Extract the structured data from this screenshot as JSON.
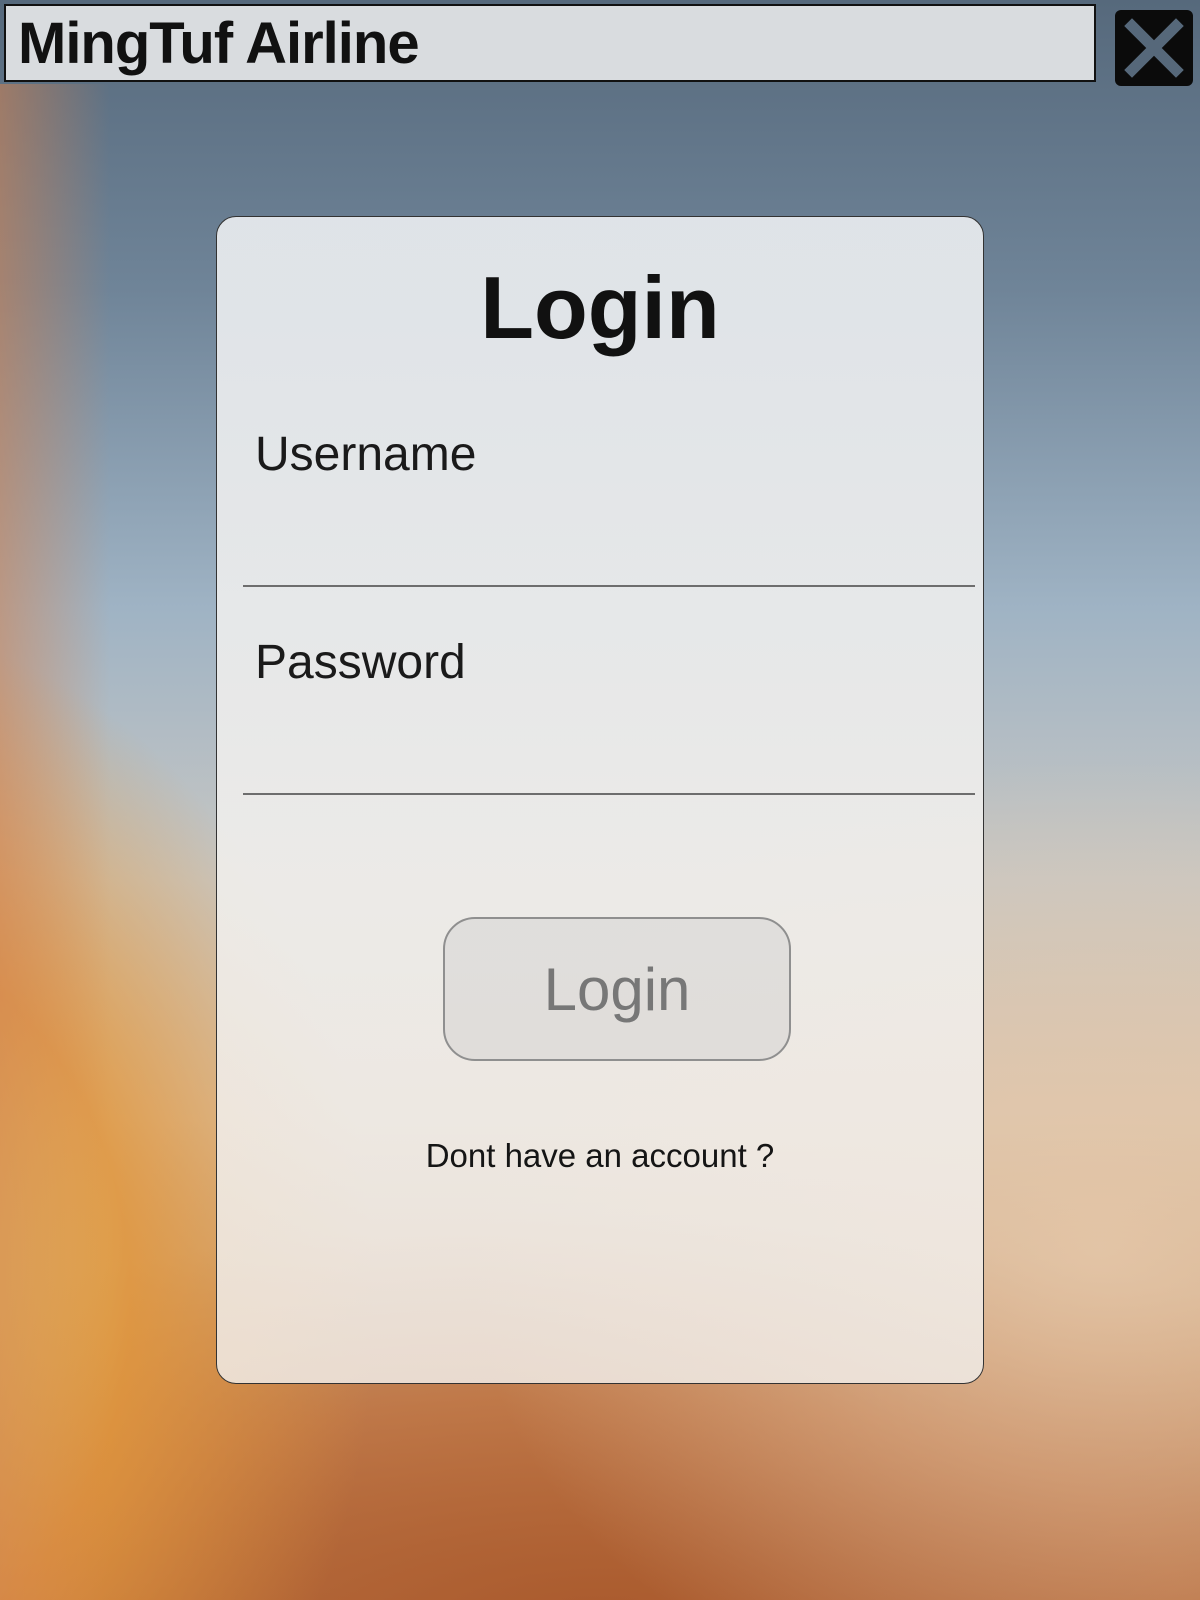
{
  "window": {
    "title": "MingTuf Airline",
    "close_icon": "close-icon"
  },
  "login_card": {
    "heading": "Login",
    "username_label": "Username",
    "username_value": "",
    "password_label": "Password",
    "password_value": "",
    "login_button": "Login",
    "signup_link": "Dont have an account ?"
  }
}
